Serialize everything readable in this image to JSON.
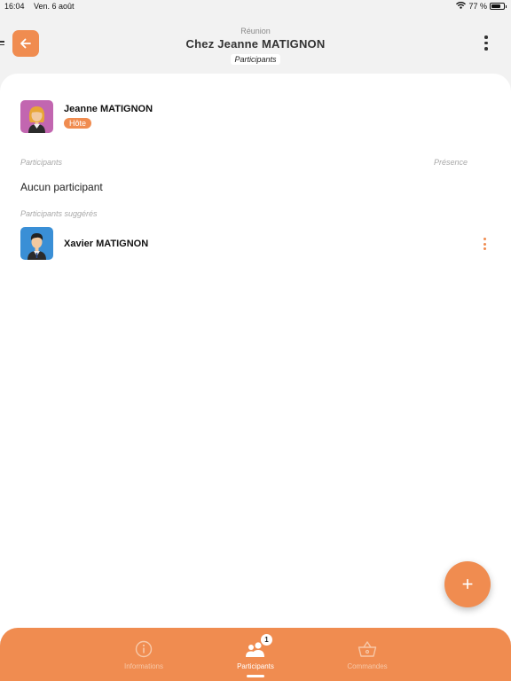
{
  "status_bar": {
    "time": "16:04",
    "date": "Ven. 6 août",
    "battery": "77 %",
    "battery_level": 0.77,
    "icons": [
      "wifi-icon",
      "battery-icon"
    ]
  },
  "header": {
    "supertitle": "Réunion",
    "title": "Chez Jeanne MATIGNON",
    "subtitle": "Participants",
    "back_icon": "arrow-left-icon",
    "menu_icon": "more-vertical-icon"
  },
  "host": {
    "name": "Jeanne MATIGNON",
    "badge": "Hôte",
    "avatar_icon": "avatar-woman-icon"
  },
  "participants": {
    "label": "Participants",
    "presence_label": "Présence",
    "empty_text": "Aucun participant"
  },
  "suggested": {
    "label": "Participants suggérés",
    "items": [
      {
        "name": "Xavier MATIGNON",
        "avatar_icon": "avatar-man-icon"
      }
    ]
  },
  "fab": {
    "label": "+"
  },
  "tabs": [
    {
      "label": "Informations",
      "icon": "info-icon",
      "active": false
    },
    {
      "label": "Participants",
      "icon": "people-icon",
      "active": true,
      "badge": "1"
    },
    {
      "label": "Commandes",
      "icon": "basket-icon",
      "active": false
    }
  ],
  "colors": {
    "accent": "#f08c50",
    "background": "#f2f2f2",
    "card": "#ffffff"
  }
}
